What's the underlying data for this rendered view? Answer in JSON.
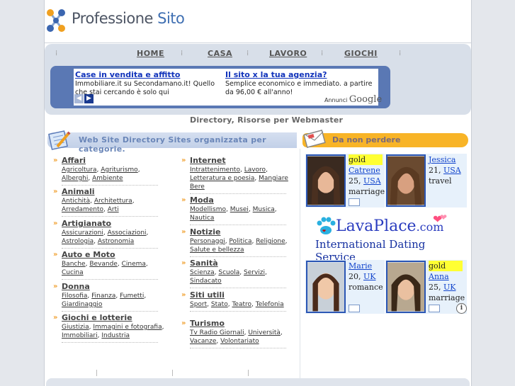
{
  "logo": {
    "part1": "Professione",
    "part2": "Sito"
  },
  "nav": {
    "items": [
      "HOME",
      "CASA",
      "LAVORO",
      "GIOCHI"
    ]
  },
  "ad": {
    "left": {
      "title": "Case in vendita e affitto",
      "text": "Immobiliare.it su Secondamano.it! Quello che stai cercando è solo qui"
    },
    "right": {
      "title": "Il sito x la tua agenzia?",
      "text": "Semplice economico e immediato. a partire da 96,00 € all'anno!"
    },
    "annunci": "Annunci",
    "google": "Google"
  },
  "tagline": "Directory, Risorse per Webmaster",
  "left_header": "Web Site Directory Sites organizzata per categorie.",
  "right_header": "Da non perdere",
  "categories_left": [
    {
      "title": "Affari",
      "links": [
        "Agricoltura",
        "Agriturismo",
        "Alberghi",
        "Ambiente"
      ]
    },
    {
      "title": "Animali",
      "links": [
        "Antichità",
        "Architettura",
        "Arredamento",
        "Arti"
      ]
    },
    {
      "title": "Artigianato",
      "links": [
        "Assicurazioni",
        "Associazioni",
        "Astrologia",
        "Astronomia"
      ]
    },
    {
      "title": "Auto e Moto",
      "links": [
        "Banche",
        "Bevande",
        "Cinema",
        "Cucina"
      ]
    },
    {
      "title": "Donna",
      "links": [
        "Filosofia",
        "Finanza",
        "Fumetti",
        "Giardinaggio"
      ]
    },
    {
      "title": "Giochi e lotterie",
      "links": [
        "Giustizia",
        "Immagini e fotografia",
        "Immobiliari",
        "Industria"
      ]
    }
  ],
  "categories_right": [
    {
      "title": "Internet",
      "links": [
        "Intrattenimento",
        "Lavoro",
        "Letteratura e poesia",
        "Mangiare Bere"
      ]
    },
    {
      "title": "Moda",
      "links": [
        "Modellismo",
        "Musei",
        "Musica",
        "Nautica"
      ]
    },
    {
      "title": "Notizie",
      "links": [
        "Personaggi",
        "Politica",
        "Religione",
        "Salute e bellezza"
      ]
    },
    {
      "title": "Sanità",
      "links": [
        "Scienza",
        "Scuola",
        "Servizi",
        "Sindacato"
      ]
    },
    {
      "title": "Siti utili",
      "links": [
        "Sport",
        "Stato",
        "Teatro",
        "Telefonia"
      ]
    },
    {
      "title": "Turismo",
      "links": [
        "Tv Radio Giornali",
        "Università",
        "Vacanze",
        "Volontariato"
      ]
    }
  ],
  "dating": {
    "profiles": [
      {
        "gold": "gold",
        "name": "Catrene",
        "age": "25",
        "country": "USA",
        "goal": "marriage"
      },
      {
        "gold": "",
        "name": "Jessica",
        "age": "21",
        "country": "USA",
        "goal": "travel"
      },
      {
        "gold": "",
        "name": "Marie",
        "age": "20",
        "country": "UK",
        "goal": "romance"
      },
      {
        "gold": "gold",
        "name": "Anna",
        "age": "25",
        "country": "UK",
        "goal": "marriage"
      }
    ],
    "brand_main": "LavaPlace",
    "brand_suffix": ".com",
    "subtitle": "International Dating Service"
  },
  "colors": {
    "nav_bg": "#d8dfe9",
    "ad_frame": "#5a78b4",
    "orange_header": "#f8b427",
    "link_blue": "#1133bb"
  }
}
